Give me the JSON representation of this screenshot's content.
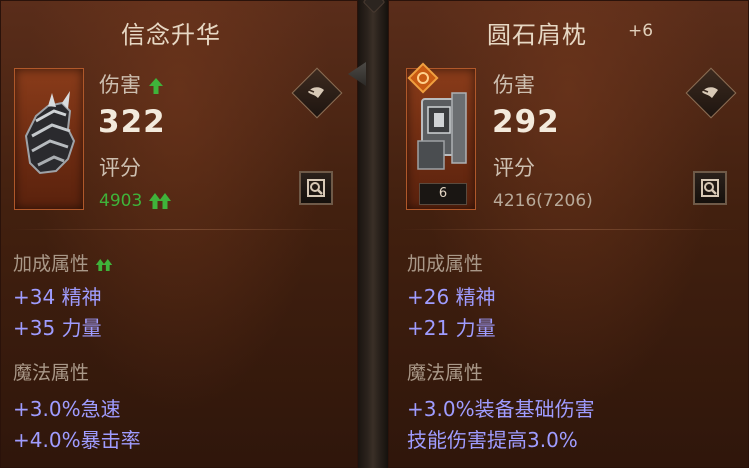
{
  "left": {
    "title": "信念升华",
    "damage_label": "伤害",
    "damage_value": "322",
    "score_label": "评分",
    "score_value": "4903",
    "bonus_section": "加成属性",
    "bonus_stats": [
      "+34 精神",
      "+35 力量"
    ],
    "magic_section": "魔法属性",
    "magic_stats": [
      "+3.0%急速",
      "+4.0%暴击率"
    ],
    "icons": [
      "gauntlet-icon",
      "up-arrow-icon",
      "double-up-arrow-icon",
      "compare-icon",
      "inspect-icon"
    ]
  },
  "right": {
    "title": "圆石肩枕",
    "title_suffix": "+6",
    "damage_label": "伤害",
    "damage_value": "292",
    "score_label": "评分",
    "score_value": "4216(7206)",
    "rank": "6",
    "bonus_section": "加成属性",
    "bonus_stats": [
      "+26 精神",
      "+21 力量"
    ],
    "magic_section": "魔法属性",
    "magic_stats": [
      "+3.0%装备基础伤害",
      "技能伤害提高3.0%"
    ],
    "icons": [
      "shoulder-armor-icon",
      "legendary-badge-icon",
      "compare-icon",
      "inspect-icon"
    ]
  },
  "colors": {
    "stat_blue": "#9f9cff",
    "up_green": "#3fb33a",
    "panel_brown": "#42200f"
  }
}
